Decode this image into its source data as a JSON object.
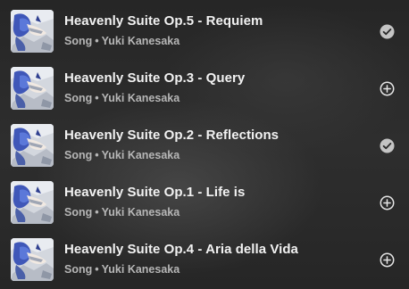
{
  "tracks": [
    {
      "title": "Heavenly Suite Op.5 - Requiem",
      "type": "Song",
      "separator": "•",
      "artist": "Yuki Kanesaka",
      "saved": true,
      "action_icon": "check-circle-icon"
    },
    {
      "title": "Heavenly Suite Op.3 - Query",
      "type": "Song",
      "separator": "•",
      "artist": "Yuki Kanesaka",
      "saved": false,
      "action_icon": "plus-circle-icon"
    },
    {
      "title": "Heavenly Suite Op.2 - Reflections",
      "type": "Song",
      "separator": "•",
      "artist": "Yuki Kanesaka",
      "saved": true,
      "action_icon": "check-circle-icon"
    },
    {
      "title": "Heavenly Suite Op.1 - Life is",
      "type": "Song",
      "separator": "•",
      "artist": "Yuki Kanesaka",
      "saved": false,
      "action_icon": "plus-circle-icon"
    },
    {
      "title": "Heavenly Suite Op.4 - Aria della Vida",
      "type": "Song",
      "separator": "•",
      "artist": "Yuki Kanesaka",
      "saved": false,
      "action_icon": "plus-circle-icon"
    }
  ],
  "colors": {
    "title": "#f2f2f2",
    "subtitle": "#b6b6b6",
    "saved_icon": "#c4c4c4",
    "add_icon": "#e6e6e6"
  }
}
